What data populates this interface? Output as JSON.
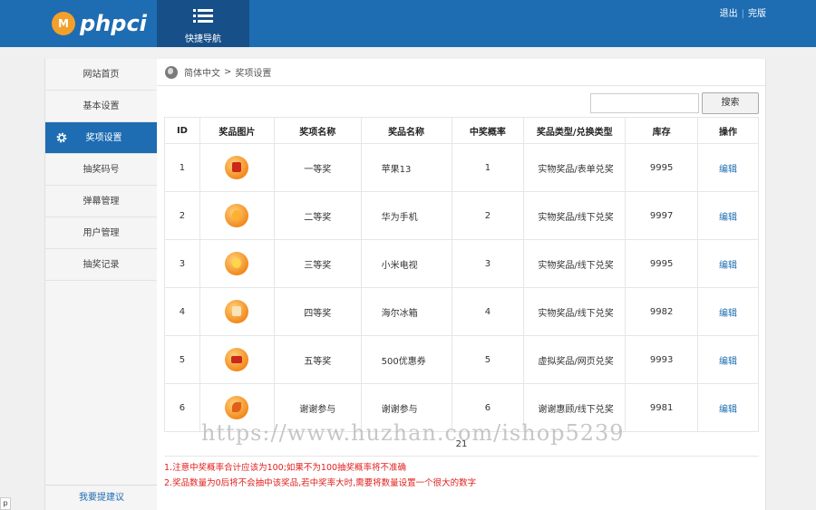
{
  "header": {
    "logo_badge": "M",
    "logo_text": "phpci",
    "quicknav_label": "快捷导航",
    "links": [
      "退出",
      "完版"
    ]
  },
  "sidebar": {
    "items": [
      {
        "label": "网站首页",
        "active": false
      },
      {
        "label": "基本设置",
        "active": false
      },
      {
        "label": "奖项设置",
        "active": true
      },
      {
        "label": "抽奖码号",
        "active": false
      },
      {
        "label": "弹幕管理",
        "active": false
      },
      {
        "label": "用户管理",
        "active": false
      },
      {
        "label": "抽奖记录",
        "active": false
      }
    ],
    "footer": "我要提建议"
  },
  "breadcrumb": {
    "root": "简体中文",
    "separator": ">",
    "current": "奖项设置"
  },
  "search": {
    "value": "",
    "button_label": "搜索"
  },
  "table": {
    "headers": [
      "ID",
      "奖品图片",
      "奖项名称",
      "奖品名称",
      "中奖概率",
      "奖品类型/兑换类型",
      "库存",
      "操作"
    ],
    "rows": [
      {
        "id": "1",
        "icon": "trophy-icon",
        "level": "一等奖",
        "prize": "苹果13",
        "prob": "1",
        "type": "实物奖品/表单兑奖",
        "stock": "9995",
        "action": "编辑"
      },
      {
        "id": "2",
        "icon": "medal-icon",
        "level": "二等奖",
        "prize": "华为手机",
        "prob": "2",
        "type": "实物奖品/线下兑奖",
        "stock": "9997",
        "action": "编辑"
      },
      {
        "id": "3",
        "icon": "coin-icon",
        "level": "三等奖",
        "prize": "小米电视",
        "prob": "3",
        "type": "实物奖品/线下兑奖",
        "stock": "9995",
        "action": "编辑"
      },
      {
        "id": "4",
        "icon": "gift-icon",
        "level": "四等奖",
        "prize": "海尔冰箱",
        "prob": "4",
        "type": "实物奖品/线下兑奖",
        "stock": "9982",
        "action": "编辑"
      },
      {
        "id": "5",
        "icon": "coupon-icon",
        "level": "五等奖",
        "prize": "500优惠券",
        "prob": "5",
        "type": "虚拟奖品/网页兑奖",
        "stock": "9993",
        "action": "编辑"
      },
      {
        "id": "6",
        "icon": "fish-icon",
        "level": "谢谢参与",
        "prize": "谢谢参与",
        "prob": "6",
        "type": "谢谢惠顾/线下兑奖",
        "stock": "9981",
        "action": "编辑"
      }
    ],
    "total": "21"
  },
  "notes": [
    "1.注意中奖概率合计应该为100;如果不为100抽奖概率将不准确",
    "2.奖品数量为0后将不会抽中该奖品,若中奖率大时,需要将数量设置一个很大的数字"
  ],
  "watermark": "https://www.huzhan.com/ishop5239",
  "corner_text": "p"
}
